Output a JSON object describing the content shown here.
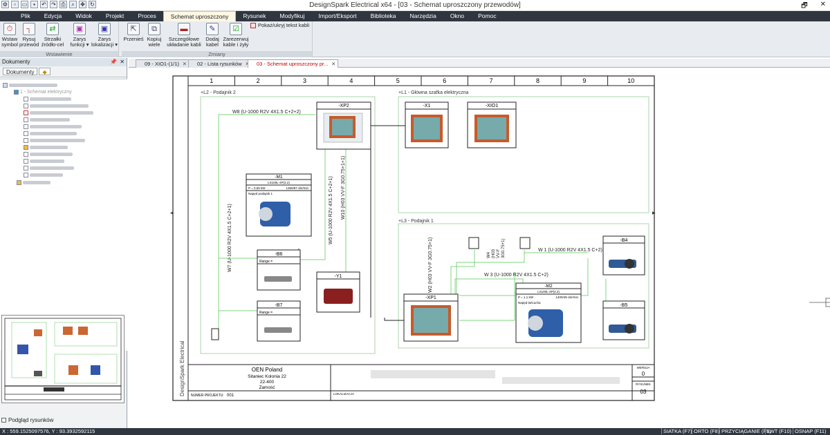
{
  "window": {
    "title": "DesignSpark Electrical x64 - [03 - Schemat uproszczony przewodów]",
    "controls": [
      "🗗",
      "✕"
    ]
  },
  "menu": [
    "Plik",
    "Edycja",
    "Widok",
    "Projekt",
    "Proces",
    "Schemat uproszczony",
    "Rysunek",
    "Modyfikuj",
    "Import/Eksport",
    "Biblioteka",
    "Narzędzia",
    "Okno",
    "Pomoc"
  ],
  "menu_active": "Schemat uproszczony",
  "ribbon": {
    "group1": {
      "label": "Wstawienie",
      "buttons": [
        {
          "l1": "Wstaw",
          "l2": "symbol"
        },
        {
          "l1": "Rysuj",
          "l2": "przewód"
        },
        {
          "l1": "Strzałki",
          "l2": "źródło-cel"
        },
        {
          "l1": "Zarys",
          "l2": "funkcji ▾"
        },
        {
          "l1": "Zarys",
          "l2": "lokalizacji ▾"
        }
      ]
    },
    "group2": {
      "label": "Zmiany",
      "buttons": [
        {
          "l1": "Przenieś",
          "l2": ""
        },
        {
          "l1": "Kopiuj",
          "l2": "wiele"
        },
        {
          "l1": "Szczegółowe",
          "l2": "układanie kabli"
        },
        {
          "l1": "Dodaj",
          "l2": "kabel"
        },
        {
          "l1": "Zarezerwuj",
          "l2": "kable i żyły"
        }
      ]
    },
    "toggle_cable_text": "Pokaż/ukryj tekst kabli"
  },
  "left_panel": {
    "title": "Dokumenty",
    "tab": "Dokumenty",
    "tree_root": "1 - Schemat elektryczny",
    "preview_label": "Podgląd rysunków"
  },
  "doc_tabs": [
    "09 - XIO1-(1/1)",
    "02 - Lista rysunków",
    "03 - Schemat uproszczony pr..."
  ],
  "doc_tab_active": 2,
  "drawing": {
    "columns": [
      "1",
      "2",
      "3",
      "4",
      "5",
      "6",
      "7",
      "8",
      "9",
      "10"
    ],
    "zones": [
      "+L2 - Podajnik 2",
      "+L1 - Główna szafka elektryczna",
      "+L3 - Podajnik 1"
    ],
    "components": {
      "xp2": "-XP2",
      "x1": "-X1",
      "xio1": "-XIO1",
      "m1": "-M1",
      "b6": "-B6",
      "b7": "-B7",
      "y1": "-Y1",
      "xp1": "-XP1",
      "m2": "-M2",
      "b4": "-B4",
      "b5": "-B5"
    },
    "m1_info": {
      "type": "LS100L-4P(2.2)",
      "power": "P = 0,55 kW",
      "speed": "1360/87 obr/min",
      "desc": "Napęd podajnik 1"
    },
    "m2_info": {
      "type": "LS100L-4P(2.2)",
      "power": "P = 1,1 kW",
      "speed": "1400/48 obr/min",
      "desc": "Napęd lańcucha"
    },
    "range_label": "Range =",
    "cables": {
      "w8": "W8 (U-1000 R2V 4X1.5 C+2+2)",
      "w7": "W7 (U-1000 R2V 4X1.5 C+2+1)",
      "w5": "W5 (U-1000 R2V 4X1.5 C+2+1)",
      "w10": "W10 (H03 VV-F 3G0.75+1+1)",
      "w1": "W 1 (U-1000 R2V 4X1.5 C+2)",
      "w3": "W 3 (U-1000 R2V 4X1.5 C+2)",
      "w2": "W2 (H03 VV-F 3G0.75+1)",
      "w4a": "W4",
      "w4b": "(H03",
      "w4c": "VV-F",
      "w4d": "3G0.75+1)"
    },
    "side_label": "DesignSpark Electrical",
    "title_block": {
      "company": "OEN Poland",
      "street": "Sitaniec Kolonia 22",
      "zip": "22-400",
      "city": "Zamość",
      "project_label": "NUMER PROJEKTU:",
      "project_number": "001",
      "loc_label": "LOKALIZACJA",
      "version_label": "WERSJA",
      "version": "0",
      "sheet_label": "RYSUNEK",
      "sheet": "03"
    }
  },
  "status": {
    "coords": "X : 559.1525097576, Y : 93.3932592115",
    "toggles": [
      "SIATKA (F7)",
      "ORTO (F8)",
      "PRZYCIĄGANIE (F9)",
      "LWT (F10)",
      "OSNAP (F11)"
    ]
  }
}
